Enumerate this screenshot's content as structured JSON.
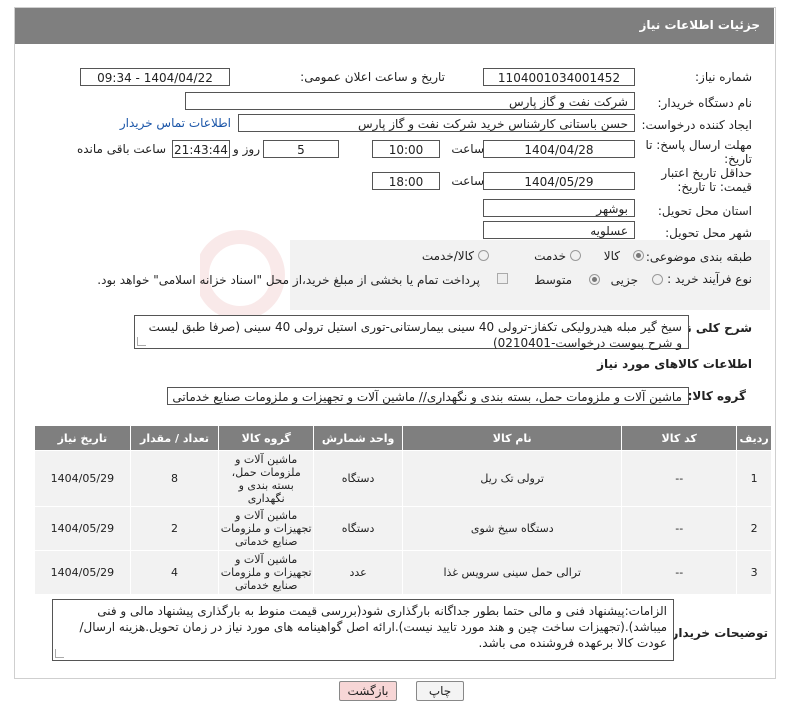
{
  "header": {
    "title": "جزئیات اطلاعات نیاز"
  },
  "form": {
    "need_number_label": "شماره نیاز:",
    "need_number": "1104001034001452",
    "announce_label": "تاریخ و ساعت اعلان عمومی:",
    "announce_value": "1404/04/22 - 09:34",
    "buyer_org_label": "نام دستگاه خریدار:",
    "buyer_org": "شرکت نفت و گاز پارس",
    "creator_label": "ایجاد کننده درخواست:",
    "creator": "حسن باستانی کارشناس خرید شرکت نفت و گاز پارس",
    "contact_link": "اطلاعات تماس خریدار",
    "deadline_label": "مهلت ارسال پاسخ: تا تاریخ:",
    "deadline_date": "1404/04/28",
    "time_label": "ساعت",
    "deadline_time": "10:00",
    "days_value": "5",
    "days_label": "روز و",
    "remaining_time": "21:43:44",
    "remaining_label": "ساعت باقی مانده",
    "price_validity_label": "حداقل تاریخ اعتبار قیمت: تا تاریخ:",
    "price_validity_date": "1404/05/29",
    "price_validity_time": "18:00",
    "province_label": "استان محل تحویل:",
    "province": "بوشهر",
    "city_label": "شهر محل تحویل:",
    "city": "عسلویه",
    "category_label": "طبقه بندی موضوعی:",
    "category_goods": "کالا",
    "category_service": "خدمت",
    "category_both": "کالا/خدمت",
    "process_label": "نوع فرآیند خرید :",
    "process_partial": "جزیی",
    "process_medium": "متوسط",
    "process_note": "پرداخت تمام یا بخشی از مبلغ خرید،از محل \"اسناد خزانه اسلامی\" خواهد بود."
  },
  "description": {
    "label": "شرح کلی نیاز:",
    "text": "سیخ گیر مبله هیدرولیکی تکفاز-ترولی 40 سینی بیمارستانی-توری استیل ترولی 40 سینی (صرفا طبق لیست و شرح پیوست درخواست-0210401)"
  },
  "goods_info": {
    "title": "اطلاعات کالاهای مورد نیاز",
    "group_label": "گروه کالا:",
    "group_value": "ماشین آلات و ملزومات حمل، بسته بندی و نگهداری// ماشین آلات و تجهیزات و ملزومات صنایع خدماتی"
  },
  "table": {
    "headers": [
      "ردیف",
      "کد کالا",
      "نام کالا",
      "واحد شمارش",
      "گروه کالا",
      "تعداد / مقدار",
      "تاریخ نیاز"
    ],
    "rows": [
      {
        "row": "1",
        "code": "--",
        "name": "ترولی تک ریل",
        "unit": "دستگاه",
        "group": "ماشین آلات و ملزومات حمل، بسته بندی و نگهداری",
        "qty": "8",
        "date": "1404/05/29"
      },
      {
        "row": "2",
        "code": "--",
        "name": "دستگاه سیخ شوی",
        "unit": "دستگاه",
        "group": "ماشین آلات و تجهیزات و ملزومات صنایع خدماتی",
        "qty": "2",
        "date": "1404/05/29"
      },
      {
        "row": "3",
        "code": "--",
        "name": "ترالی حمل سینی سرویس غذا",
        "unit": "عدد",
        "group": "ماشین آلات و تجهیزات و ملزومات صنایع خدماتی",
        "qty": "4",
        "date": "1404/05/29"
      }
    ]
  },
  "buyer_notes": {
    "label": "توضیحات خریدار:",
    "text": "الزامات:پیشنهاد فنی و مالی حتما  بطور جداگانه بارگذاری شود(بررسی قیمت منوط به بارگذاری پیشنهاد مالی و فنی میباشد).(تجهیزات ساخت چین و هند مورد تایید نیست).ارائه اصل گواهینامه های مورد نیاز در زمان تحویل.هزینه ارسال/عودت کالا برعهده فروشنده می باشد."
  },
  "buttons": {
    "print": "چاپ",
    "back": "بازگشت"
  },
  "colors": {
    "header": "#7f7f7f",
    "link": "#1a55a8",
    "back_button": "#f7d6d6"
  }
}
